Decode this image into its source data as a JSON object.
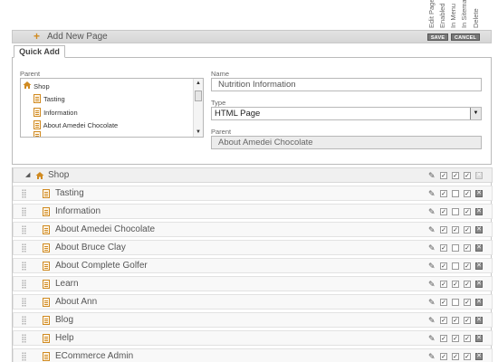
{
  "columns": [
    "Edit Page",
    "Enabled",
    "In Menu",
    "In Sitemap",
    "Delete"
  ],
  "add_bar": {
    "label": "Add New Page",
    "save": "SAVE",
    "cancel": "CANCEL"
  },
  "quick_add": {
    "tab": "Quick Add",
    "parent_label": "Parent",
    "tree": [
      "Shop",
      "Tasting",
      "Information",
      "About Amedei Chocolate"
    ],
    "name_label": "Name",
    "name_value": "Nutrition Information",
    "type_label": "Type",
    "type_value": "HTML Page",
    "parent_field_label": "Parent",
    "parent_value": "About Amedei Chocolate"
  },
  "tree_rows": [
    {
      "label": "Shop",
      "enabled": true,
      "menu": true,
      "sitemap": true,
      "root": true
    },
    {
      "label": "Tasting",
      "enabled": true,
      "menu": false,
      "sitemap": true
    },
    {
      "label": "Information",
      "enabled": true,
      "menu": false,
      "sitemap": true
    },
    {
      "label": "About Amedei Chocolate",
      "enabled": true,
      "menu": true,
      "sitemap": true
    },
    {
      "label": "About Bruce Clay",
      "enabled": true,
      "menu": false,
      "sitemap": true
    },
    {
      "label": "About Complete Golfer",
      "enabled": true,
      "menu": false,
      "sitemap": true
    },
    {
      "label": "Learn",
      "enabled": true,
      "menu": true,
      "sitemap": true
    },
    {
      "label": "About Ann",
      "enabled": true,
      "menu": false,
      "sitemap": true
    },
    {
      "label": "Blog",
      "enabled": true,
      "menu": true,
      "sitemap": true
    },
    {
      "label": "Help",
      "enabled": true,
      "menu": true,
      "sitemap": true
    },
    {
      "label": "ECommerce Admin",
      "enabled": true,
      "menu": true,
      "sitemap": true
    }
  ],
  "colors": {
    "accent": "#d08a20",
    "bar": "#dcdcdc",
    "button": "#777777"
  }
}
